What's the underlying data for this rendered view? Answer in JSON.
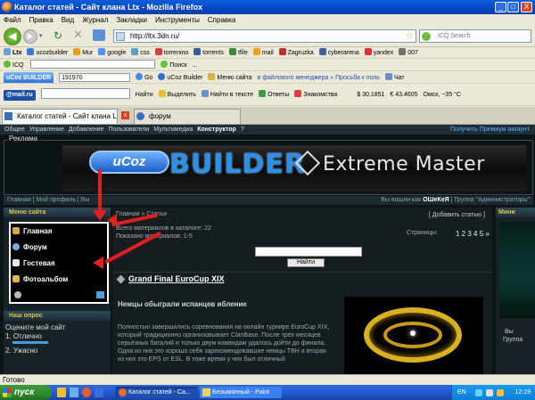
{
  "window": {
    "title": "Каталог статей - Сайт клана Ltx - Mozilla Firefox",
    "min": "_",
    "max": "□",
    "close": "X"
  },
  "menu": [
    "Файл",
    "Правка",
    "Вид",
    "Журнал",
    "Закладки",
    "Инструменты",
    "Справка"
  ],
  "nav": {
    "url": "http://ltx.3dn.ru/",
    "search_placeholder": "ICQ Search"
  },
  "bookmarks": [
    "Ltx",
    "ucozbuilder",
    "Mur",
    "google",
    "css",
    "torrenino",
    "torrents",
    "tfile",
    "mail",
    "Zagruzka",
    "cyberarena",
    "yandex",
    "007"
  ],
  "icq_bar": {
    "label": "ICQ",
    "search": "Поиск",
    "extra": "..."
  },
  "ucoz_bar": {
    "brand": "uCoz BUILDER",
    "id": "191970",
    "go": "Go",
    "builder": "uCoz Builder",
    "menu": "Меню сайта",
    "ticker": "в файлового менеджера » Просьба к поль",
    "chat": "Чат"
  },
  "mail_bar": {
    "brand": "@mail.ru",
    "find": "Найти",
    "highlight": "Выделить",
    "find_text": "Найти в тексте",
    "answers": "Ответы",
    "dating": "Знакомства",
    "usd": "$ 30.1851",
    "eur": "€ 43.4605",
    "weather": "Омск, −35 °C"
  },
  "tabs": [
    "Каталог статей - Сайт клана Ltx",
    "форум"
  ],
  "site": {
    "topnav": [
      "Общее",
      "Управление",
      "Добавление",
      "Пользователи",
      "Мультимедиа",
      "Конструктор",
      "?"
    ],
    "premium": "Получить Премиум аккаунт",
    "reklama": "Реклама",
    "banner": {
      "logo": "uCoz",
      "builder": "BUILDER",
      "extreme": "Extreme Master"
    },
    "userbar": {
      "links": "Главная | Мой профиль | Вы",
      "login": "Вы вошли как",
      "user": "OШeКeЯ",
      "group": "| Группа \"Администраторы\""
    },
    "sidebar": {
      "menu_title": "Меню сайта",
      "items": [
        "Главная",
        "Форум",
        "Гостевая",
        "Фотоальбом"
      ],
      "poll_title": "Наш опрос",
      "poll_q": "Оцените мой сайт",
      "poll_a1": "1. Отлично",
      "poll_a2": "2. Ужасно"
    },
    "main": {
      "crumb": "Главная » Статьи",
      "add": "[ Добавить статью ]",
      "total": "Всего материалов в каталоге: 22",
      "shown": "Показано материалов: 1-5",
      "pages_label": "Страницы:",
      "pages": "1 2 3 4 5 »",
      "search_btn": "Найти",
      "article_title": "Grand Final EuroCup XIX",
      "article_sub": "Немцы обыграли испанцев иблениe",
      "article_body": "Полностью завершились соревнования на онлайн турнире EuroCup XIX, который традиционно организовывает ClanBase. После трёх месяцев серьёзных баталий и только двум командам удалось дойти до финала. Одна из них это хорошо себя зарекомендовавшие немцы TBH а вторая из них это EPS от ESL. В тоже время у них был отличный"
    },
    "right": {
      "title": "Мини",
      "l1": "Вы",
      "l2": "Группа"
    }
  },
  "status": "Готово",
  "taskbar": {
    "start": "пуск",
    "tasks": [
      "Каталог статей - Са...",
      "Безымянный - Paint"
    ],
    "lang": "EN",
    "time": "12:19"
  }
}
